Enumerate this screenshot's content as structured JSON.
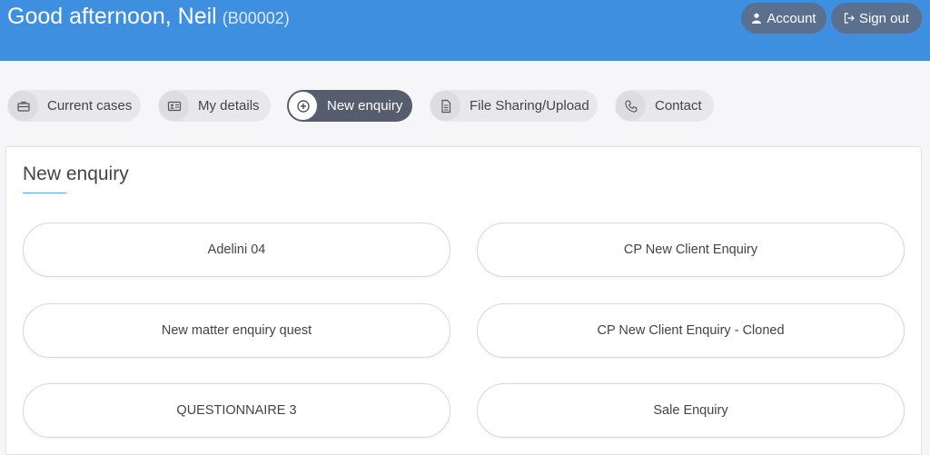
{
  "header": {
    "greeting": "Good afternoon, Neil",
    "client_code": "(B00002)",
    "account_label": "Account",
    "signout_label": "Sign out"
  },
  "nav": {
    "items": [
      {
        "label": "Current cases",
        "icon": "briefcase-icon",
        "active": false
      },
      {
        "label": "My details",
        "icon": "id-card-icon",
        "active": false
      },
      {
        "label": "New enquiry",
        "icon": "plus-circle-icon",
        "active": true
      },
      {
        "label": "File Sharing/Upload",
        "icon": "document-icon",
        "active": false
      },
      {
        "label": "Contact",
        "icon": "phone-icon",
        "active": false
      }
    ]
  },
  "panel": {
    "title": "New enquiry",
    "enquiries": [
      "Adelini 04",
      "CP New Client Enquiry",
      "New matter enquiry quest",
      "CP New Client Enquiry - Cloned",
      "QUESTIONNAIRE 3",
      "Sale Enquiry"
    ]
  },
  "colors": {
    "header_bg": "#3f8fe0",
    "header_button": "#5b6f8f",
    "active_pill": "#565d6d",
    "accent_underline": "#5ca8e0"
  }
}
